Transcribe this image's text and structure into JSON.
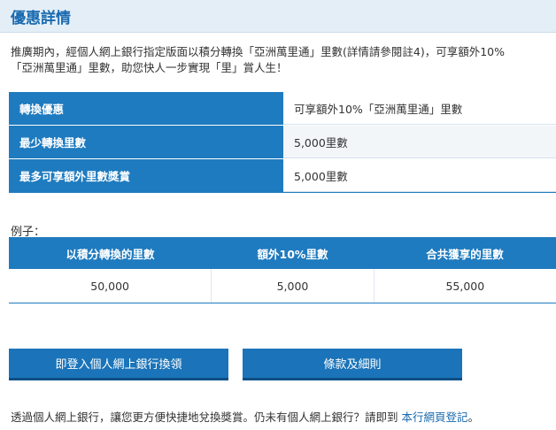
{
  "title": "優惠詳情",
  "intro": {
    "line1": "推廣期內，經個人網上銀行指定版面以積分轉換「亞洲萬里通」里數(詳情請參閱註4)，可享額外10%",
    "line2": "「亞洲萬里通」里數，助您快人一步實現「里」賞人生！"
  },
  "offer_table": [
    {
      "label": "轉換優惠",
      "value": "可享額外10%「亞洲萬里通」里數"
    },
    {
      "label": "最少轉換里數",
      "value": "5,000里數"
    },
    {
      "label": "最多可享額外里數獎賞",
      "value": "5,000里數"
    }
  ],
  "example": {
    "label": "例子：",
    "headers": [
      "以積分轉換的里數",
      "額外10%里數",
      "合共獲享的里數"
    ],
    "row": [
      "50,000",
      "5,000",
      "55,000"
    ]
  },
  "buttons": {
    "login": "即登入個人網上銀行換領",
    "terms": "條款及細則"
  },
  "footer": {
    "text": "透過個人網上銀行，讓您更方便快捷地兌換獎賞。仍未有個人網上銀行？請即到 ",
    "link": "本行網頁登記",
    "end": "。"
  }
}
